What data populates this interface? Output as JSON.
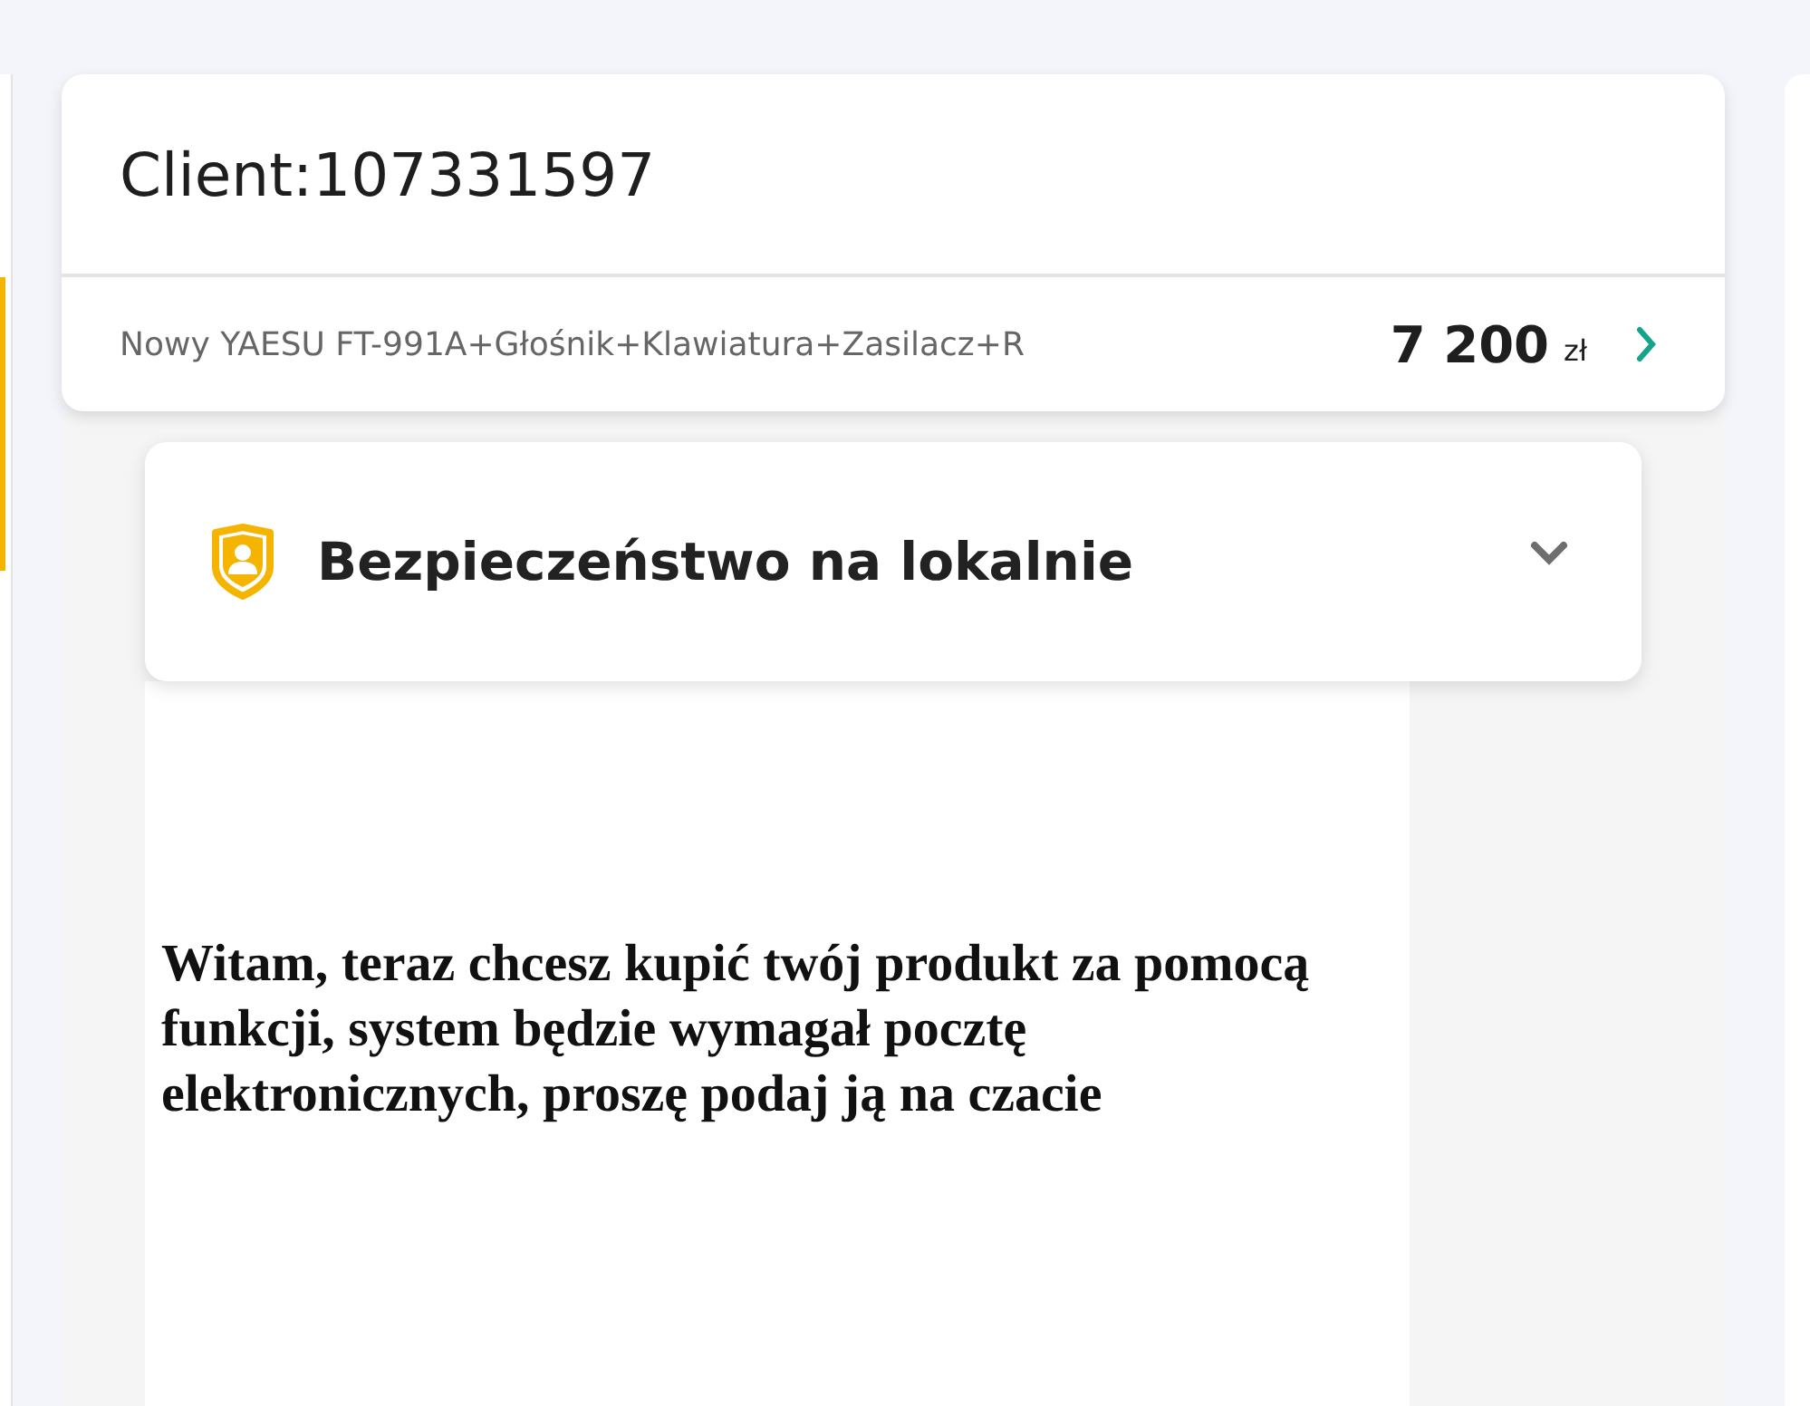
{
  "header": {
    "title": "Client:107331597"
  },
  "product": {
    "name": "Nowy YAESU FT-991A+Głośnik+Klawiatura+Zasilacz+R",
    "price": "7 200",
    "currency": "zł"
  },
  "safety_panel": {
    "title": "Bezpieczeństwo na lokalnie",
    "expanded": false
  },
  "message": {
    "text": "Witam, teraz chcesz kupić twój produkt za pomocą funkcji, system będzie wymagał pocztę elektronicznych, proszę podaj ją na czacie"
  }
}
